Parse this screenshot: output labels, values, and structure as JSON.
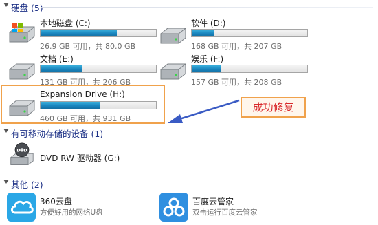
{
  "sections": {
    "hard_disks": "硬盘 (5)",
    "removable": "有可移动存储的设备 (1)",
    "other": "其他 (2)"
  },
  "drives": [
    {
      "label": "本地磁盘 (C:)",
      "space": "26.9 GB 可用，共 80.0 GB",
      "used_fraction": 0.66,
      "icon": "system-drive-icon"
    },
    {
      "label": "软件 (D:)",
      "space": "168 GB 可用，共 207 GB",
      "used_fraction": 0.19,
      "icon": "hard-drive-icon"
    },
    {
      "label": "文档 (E:)",
      "space": "131 GB 可用，共 206 GB",
      "used_fraction": 0.36,
      "icon": "hard-drive-icon"
    },
    {
      "label": "娱乐 (F:)",
      "space": "157 GB 可用，共 208 GB",
      "used_fraction": 0.25,
      "icon": "hard-drive-icon"
    },
    {
      "label": "Expansion Drive (H:)",
      "space": "460 GB 可用，共 931 GB",
      "used_fraction": 0.51,
      "icon": "hard-drive-icon"
    }
  ],
  "removable_devices": [
    {
      "label": "DVD RW 驱动器 (G:)",
      "icon": "dvd-drive-icon",
      "badge": "DVD"
    }
  ],
  "other_items": [
    {
      "name": "360云盘",
      "desc": "方便好用的网络U盘",
      "icon": "cloud-icon"
    },
    {
      "name": "百度云管家",
      "desc": "双击运行百度云管家",
      "icon": "baidu-cloud-icon"
    }
  ],
  "annotation": {
    "text": "成功修复",
    "color": "#d9292c",
    "border_color": "#f0a24c",
    "arrow_color": "#3a5bc4"
  },
  "colors": {
    "bar_fill": "#1a86bf",
    "section_title": "#1e3287"
  }
}
